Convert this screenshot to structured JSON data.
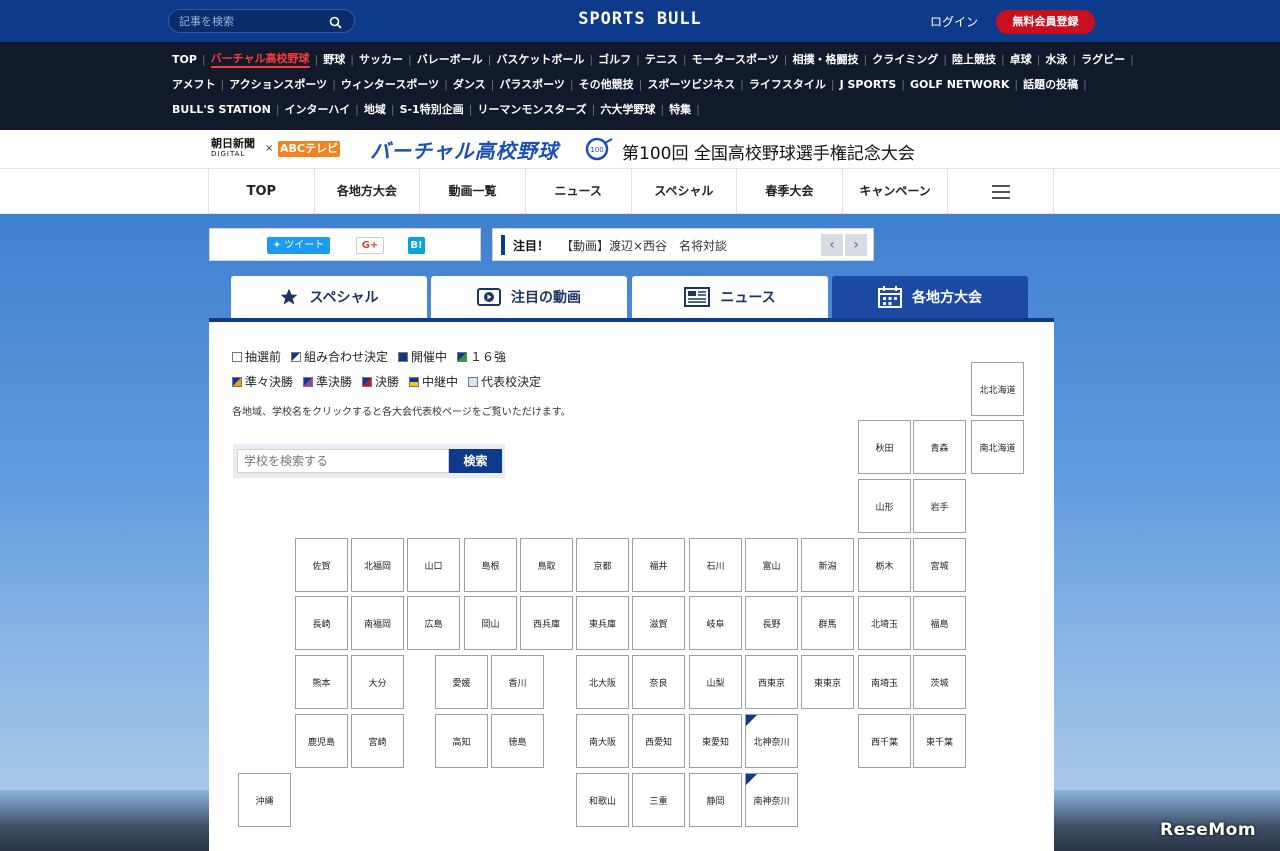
{
  "topbar": {
    "search_placeholder": "記事を検索",
    "logo": "SPORTS BULL",
    "login": "ログイン",
    "register": "無料会員登録"
  },
  "catnav": {
    "rows": [
      [
        "TOP",
        "バーチャル高校野球",
        "野球",
        "サッカー",
        "バレーボール",
        "バスケットボール",
        "ゴルフ",
        "テニス",
        "モータースポーツ",
        "相撲・格闘技",
        "クライミング",
        "陸上競技",
        "卓球",
        "水泳",
        "ラグビー"
      ],
      [
        "アメフト",
        "アクションスポーツ",
        "ウィンタースポーツ",
        "ダンス",
        "パラスポーツ",
        "その他競技",
        "スポーツビジネス",
        "ライフスタイル",
        "J SPORTS",
        "GOLF NETWORK",
        "話題の投稿"
      ],
      [
        "BULL'S STATION",
        "インターハイ",
        "地域",
        "S-1特別企画",
        "リーマンモンスターズ",
        "六大学野球",
        "特集"
      ]
    ],
    "active": "バーチャル高校野球"
  },
  "brand": {
    "asahi": "朝日新聞",
    "asahi_sub": "DIGITAL",
    "cross": "×",
    "abc": "ABCテレビ",
    "vbb": "バーチャル高校野球",
    "badge": "100",
    "centennial": "第100回 全国高校野球選手権記念大会"
  },
  "mainnav": [
    "TOP",
    "各地方大会",
    "動画一覧",
    "ニュース",
    "スペシャル",
    "春季大会",
    "キャンペーン"
  ],
  "share": {
    "tweet": "ツイート",
    "gplus": "G+",
    "hatena": "B!"
  },
  "notice": {
    "label": "注目！",
    "text": "【動画】渡辺×西谷　名将対談"
  },
  "tabs": [
    "スペシャル",
    "注目の動画",
    "ニュース",
    "各地方大会"
  ],
  "legend": {
    "row1": [
      "抽選前",
      "組み合わせ決定",
      "開催中",
      "１６強"
    ],
    "row2": [
      "準々決勝",
      "準決勝",
      "決勝",
      "中継中",
      "代表校決定"
    ]
  },
  "colors": {
    "primary": "#0d3a8a",
    "accent_red": "#c8101e",
    "tab_active": "#1c4aa3"
  },
  "description": "各地域、学校名をクリックすると各大会代表校ページをご覧いただけます。",
  "school_search": {
    "placeholder": "学校を検索する",
    "button": "検索"
  },
  "prefectures": [
    {
      "name": "北北海道"
    },
    {
      "name": "南北海道"
    },
    {
      "name": "秋田"
    },
    {
      "name": "青森"
    },
    {
      "name": "山形"
    },
    {
      "name": "岩手"
    },
    {
      "name": "佐賀"
    },
    {
      "name": "北福岡"
    },
    {
      "name": "山口"
    },
    {
      "name": "島根"
    },
    {
      "name": "鳥取"
    },
    {
      "name": "京都"
    },
    {
      "name": "福井"
    },
    {
      "name": "石川"
    },
    {
      "name": "富山"
    },
    {
      "name": "新潟"
    },
    {
      "name": "栃木"
    },
    {
      "name": "宮城"
    },
    {
      "name": "長崎"
    },
    {
      "name": "南福岡"
    },
    {
      "name": "広島"
    },
    {
      "name": "岡山"
    },
    {
      "name": "西兵庫"
    },
    {
      "name": "東兵庫"
    },
    {
      "name": "滋賀"
    },
    {
      "name": "岐阜"
    },
    {
      "name": "長野"
    },
    {
      "name": "群馬"
    },
    {
      "name": "北埼玉"
    },
    {
      "name": "福島"
    },
    {
      "name": "熊本"
    },
    {
      "name": "大分"
    },
    {
      "name": "愛媛"
    },
    {
      "name": "香川"
    },
    {
      "name": "北大阪"
    },
    {
      "name": "奈良"
    },
    {
      "name": "山梨"
    },
    {
      "name": "西東京"
    },
    {
      "name": "東東京"
    },
    {
      "name": "南埼玉"
    },
    {
      "name": "茨城"
    },
    {
      "name": "鹿児島"
    },
    {
      "name": "宮崎"
    },
    {
      "name": "高知"
    },
    {
      "name": "徳島"
    },
    {
      "name": "南大阪"
    },
    {
      "name": "西愛知"
    },
    {
      "name": "東愛知"
    },
    {
      "name": "北神奈川",
      "status": "組み合わせ決定"
    },
    {
      "name": "西千葉"
    },
    {
      "name": "東千葉"
    },
    {
      "name": "沖縄"
    },
    {
      "name": "和歌山"
    },
    {
      "name": "三重"
    },
    {
      "name": "静岡"
    },
    {
      "name": "南神奈川",
      "status": "組み合わせ決定"
    }
  ],
  "watermark": "ReseMom"
}
